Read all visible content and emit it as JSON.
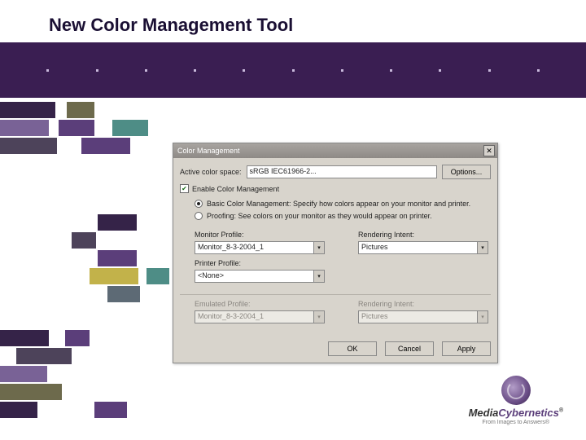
{
  "slide": {
    "title": "New Color Management Tool"
  },
  "dialog": {
    "title": "Color Management",
    "active_color_space_label": "Active color space:",
    "active_color_space_value": "sRGB IEC61966-2...",
    "options_button": "Options...",
    "enable_label": "Enable Color Management",
    "radio_basic": "Basic Color Management: Specify how colors appear on your monitor and printer.",
    "radio_proofing": "Proofing: See colors on your monitor as they would appear on printer.",
    "monitor_profile_label": "Monitor Profile:",
    "monitor_profile_value": "Monitor_8-3-2004_1",
    "printer_profile_label": "Printer Profile:",
    "printer_profile_value": "<None>",
    "rendering_intent_label": "Rendering Intent:",
    "rendering_intent_value": "Pictures",
    "emulated_profile_label": "Emulated Profile:",
    "emulated_profile_value": "Monitor_8-3-2004_1",
    "rendering_intent2_label": "Rendering Intent:",
    "rendering_intent2_value": "Pictures",
    "ok": "OK",
    "cancel": "Cancel",
    "apply": "Apply"
  },
  "branding": {
    "brand_media": "Media",
    "brand_cyber": "Cybernetics",
    "reg": "®",
    "tagline": "From Images to Answers®"
  },
  "palette": {
    "dark_purple": "#352348",
    "mid_purple": "#5b3e7a",
    "light_purple": "#796296",
    "grey_purple": "#4d435a",
    "brown_olive": "#6d6a4c",
    "teal": "#4e8d86",
    "mustard": "#c2b24a",
    "slate": "#5d6a75"
  }
}
